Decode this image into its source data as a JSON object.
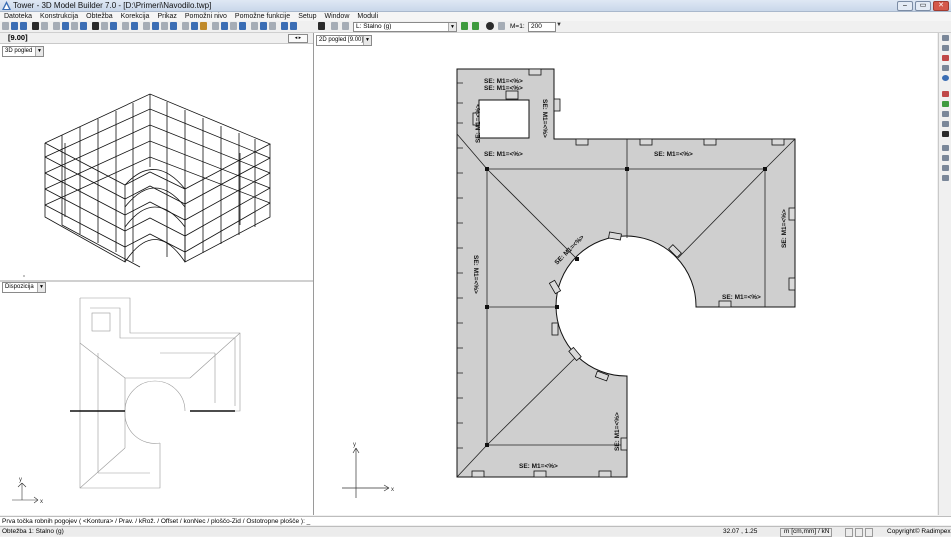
{
  "window": {
    "title": "Tower - 3D Model Builder 7.0 - [D:\\Primeri\\Navodilo.twp]"
  },
  "menu": [
    "Datoteka",
    "Konstrukcija",
    "Obtežba",
    "Korekcija",
    "Prikaz",
    "Pomožni nivo",
    "Pomožne funkcije",
    "Setup",
    "Window",
    "Moduli"
  ],
  "toolbar": {
    "load_case": "L: Stalno (g)",
    "m_label": "M=1:",
    "m_value": "200"
  },
  "left_top": {
    "coord": "[9.00]",
    "view_combo": "3D pogled"
  },
  "left_bottom": {
    "view_combo": "Dispozicija"
  },
  "main": {
    "view_combo": "2D pogled  [9.00]",
    "load_label": "SE: M1=<%>",
    "axis_x": "x",
    "axis_y": "y"
  },
  "cmdline": "Prva točka robnih pogojev ( <Kontura> / Prav. / kRož. / Offset / konNec / ploščo-Zid / Ostotropne plošče ): _",
  "status": {
    "load": "Obtežba 1: Stalno (g)",
    "coords": "32.07 , 1.25",
    "units": "m [cm,mm] / kN",
    "copyright": "Copyright© Radimpex"
  }
}
